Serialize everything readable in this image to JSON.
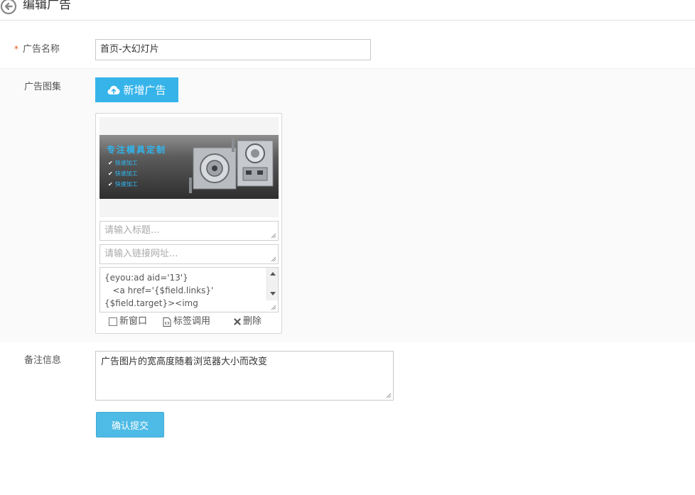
{
  "header": {
    "title": "编辑广告",
    "back_icon": "back-arrow-icon"
  },
  "form": {
    "name_label": "广告名称",
    "required_mark": "*",
    "name_value": "首页-大幻灯片",
    "gallery_label": "广告图集",
    "add_button_label": "新增广告",
    "add_button_icon": "cloud-upload-icon",
    "notes_label": "备注信息",
    "notes_value": "广告图片的宽高度随着浏览器大小而改变",
    "submit_label": "确认提交"
  },
  "ad_item": {
    "banner": {
      "title": "专注模具定制",
      "lines": [
        "快速加工",
        "快速加工",
        "快速加工"
      ]
    },
    "title_placeholder": "请输入标题...",
    "link_placeholder": "请输入链接网址...",
    "code_lines": [
      "{eyou:ad aid='13'}",
      "   <a href='{$field.links}'",
      "{$field.target}><img"
    ],
    "actions": {
      "new_window": "新窗口",
      "tag_call": "标签调用",
      "delete": "删除"
    }
  },
  "colors": {
    "accent": "#36b4ea",
    "required": "#e4571c",
    "submit": "#4ebbe6"
  }
}
